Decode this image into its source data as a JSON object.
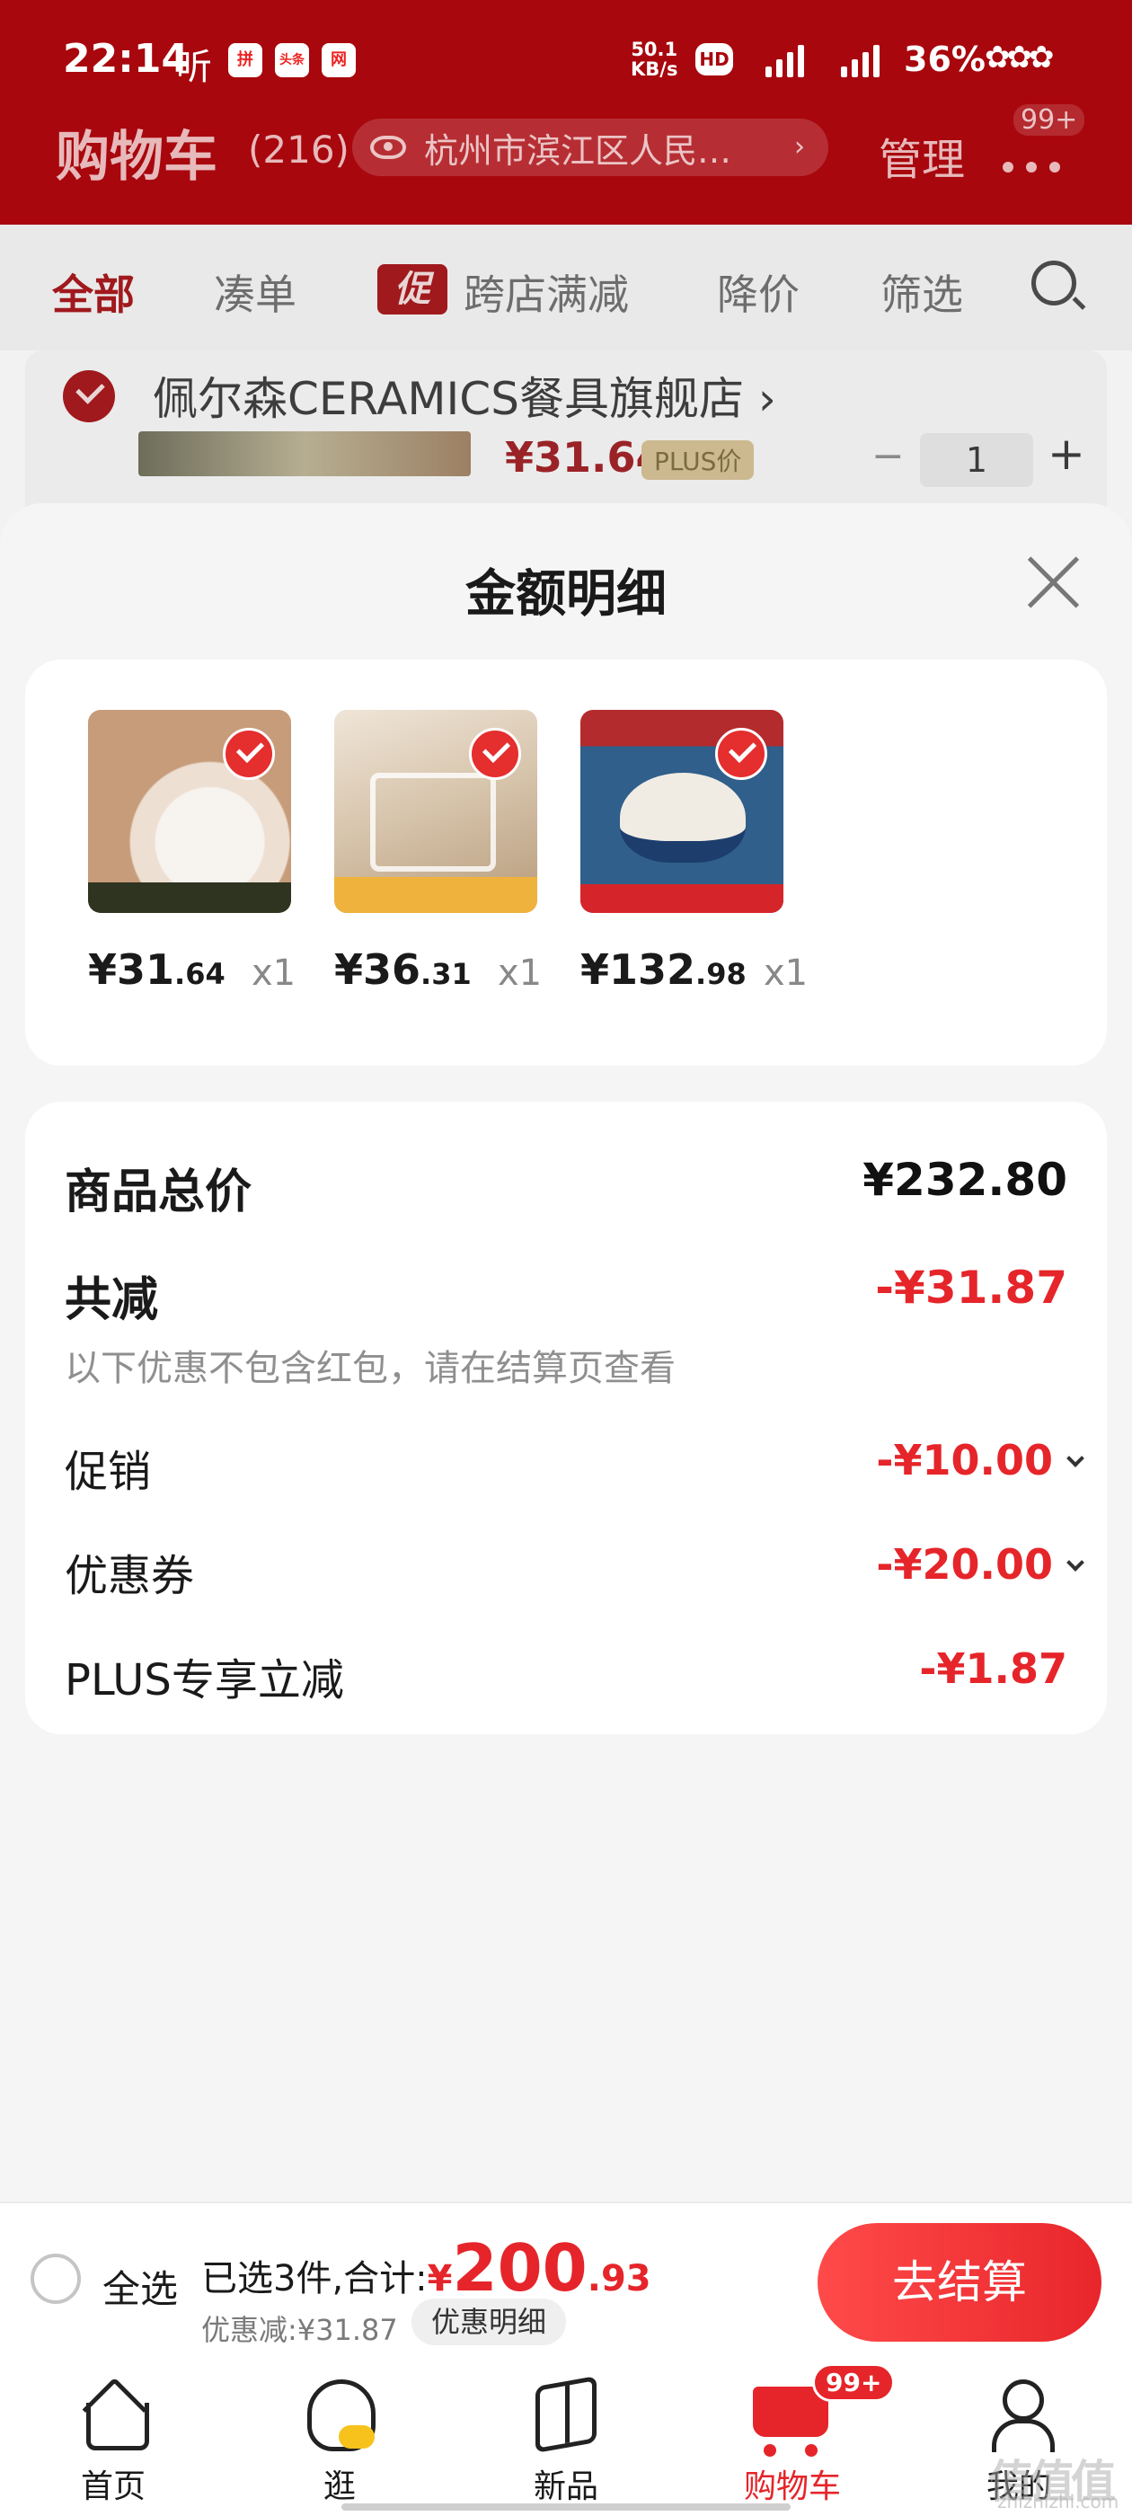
{
  "status_bar": {
    "time": "22:14",
    "listen": "听",
    "speed": "50.1\nKB/s",
    "hd": "HD",
    "battery": "36%",
    "app_icons": [
      "拼",
      "头条",
      "网"
    ]
  },
  "header": {
    "title": "购物车",
    "count": "(216)",
    "location": "杭州市滨江区人民…",
    "manage": "管理",
    "message_badge": "99+"
  },
  "filter_tabs": {
    "all": "全部",
    "combine": "凑单",
    "promo_badge": "促",
    "cross_store": "跨店满减",
    "price_drop": "降价",
    "filter": "筛选"
  },
  "background_shop": {
    "name": "佩尔森CERAMICS餐具旗舰店 ›",
    "price": "¥31.64",
    "plus_tag": "PLUS价",
    "qty_minus": "−",
    "qty": "1",
    "qty_plus": "+"
  },
  "sheet": {
    "title": "金额明细",
    "items": [
      {
        "price_int": "¥31",
        "price_dec": ".64",
        "qty": "x1"
      },
      {
        "price_int": "¥36",
        "price_dec": ".31",
        "qty": "x1"
      },
      {
        "price_int": "¥132",
        "price_dec": ".98",
        "qty": "x1"
      }
    ],
    "summary": {
      "total_label": "商品总价",
      "total_value": "¥232.80",
      "reduce_label": "共减",
      "reduce_value": "-¥31.87",
      "reduce_note": "以下优惠不包含红包，请在结算页查看",
      "promo_label": "促销",
      "promo_value": "-¥10.00",
      "coupon_label": "优惠券",
      "coupon_value": "-¥20.00",
      "plus_label": "PLUS专享立减",
      "plus_value": "-¥1.87"
    }
  },
  "checkout": {
    "select_all": "全选",
    "selected_text": "已选3件,合计:",
    "yen": "¥",
    "total_int": "200",
    "total_dec": ".93",
    "discount_text": "优惠减:¥31.87",
    "detail_chip": "优惠明细",
    "button": "去结算"
  },
  "tabbar": {
    "home": "首页",
    "stroll": "逛",
    "new": "新品",
    "cart": "购物车",
    "cart_badge": "99+",
    "me": "我的"
  },
  "watermark": {
    "main": "值值值",
    "sub": "zhizhizhi.com"
  },
  "colors": {
    "brand_red": "#e5252a",
    "header_red": "#a8070d"
  }
}
